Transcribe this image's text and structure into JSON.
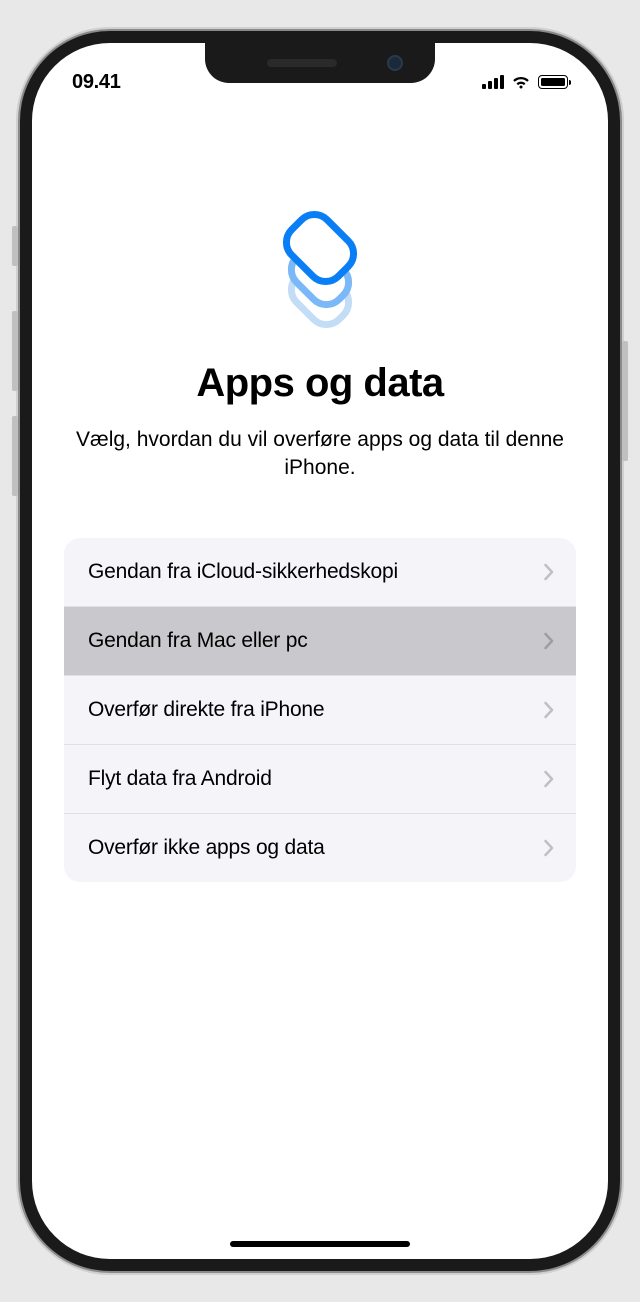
{
  "status_bar": {
    "time": "09.41"
  },
  "screen": {
    "title": "Apps og data",
    "subtitle": "Vælg, hvordan du vil overføre apps og data til denne iPhone.",
    "hero_icon": "data-stack-icon"
  },
  "options": [
    {
      "label": "Gendan fra iCloud-sikkerhedskopi",
      "selected": false
    },
    {
      "label": "Gendan fra Mac eller pc",
      "selected": true
    },
    {
      "label": "Overfør direkte fra iPhone",
      "selected": false
    },
    {
      "label": "Flyt data fra Android",
      "selected": false
    },
    {
      "label": "Overfør ikke apps og data",
      "selected": false
    }
  ],
  "colors": {
    "accent": "#0a7ff5",
    "accent_light": "#7ab8f7",
    "accent_lighter": "#c3ddf7"
  }
}
